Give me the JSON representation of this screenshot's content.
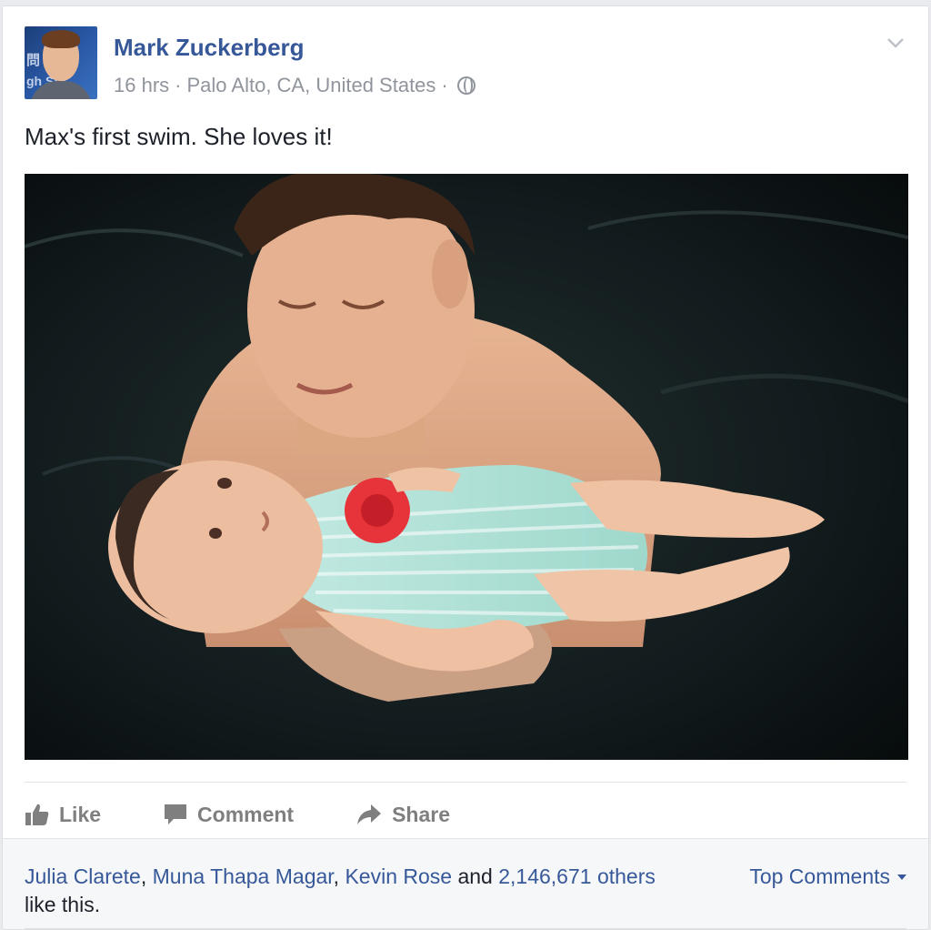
{
  "post": {
    "author": "Mark Zuckerberg",
    "time": "16 hrs",
    "sep1": "·",
    "location": "Palo Alto, CA, United States",
    "sep2": "·",
    "privacy_icon": "globe-icon",
    "options_icon": "chevron-down-icon",
    "message": "Max's first swim. She loves it!",
    "avatar_text_top": "問 委",
    "avatar_text_bottom": "gh Stu"
  },
  "actions": {
    "like": "Like",
    "comment": "Comment",
    "share": "Share"
  },
  "likes": {
    "names": [
      "Julia Clarete",
      "Muna Thapa Magar",
      "Kevin Rose"
    ],
    "comma1": ",",
    "comma2": ",",
    "and_text": "and",
    "others": "2,146,671 others",
    "tail": "like this."
  },
  "comments": {
    "sort_label": "Top Comments"
  },
  "colors": {
    "link": "#365899",
    "muted": "#90949c",
    "action": "#7f7f7f"
  }
}
